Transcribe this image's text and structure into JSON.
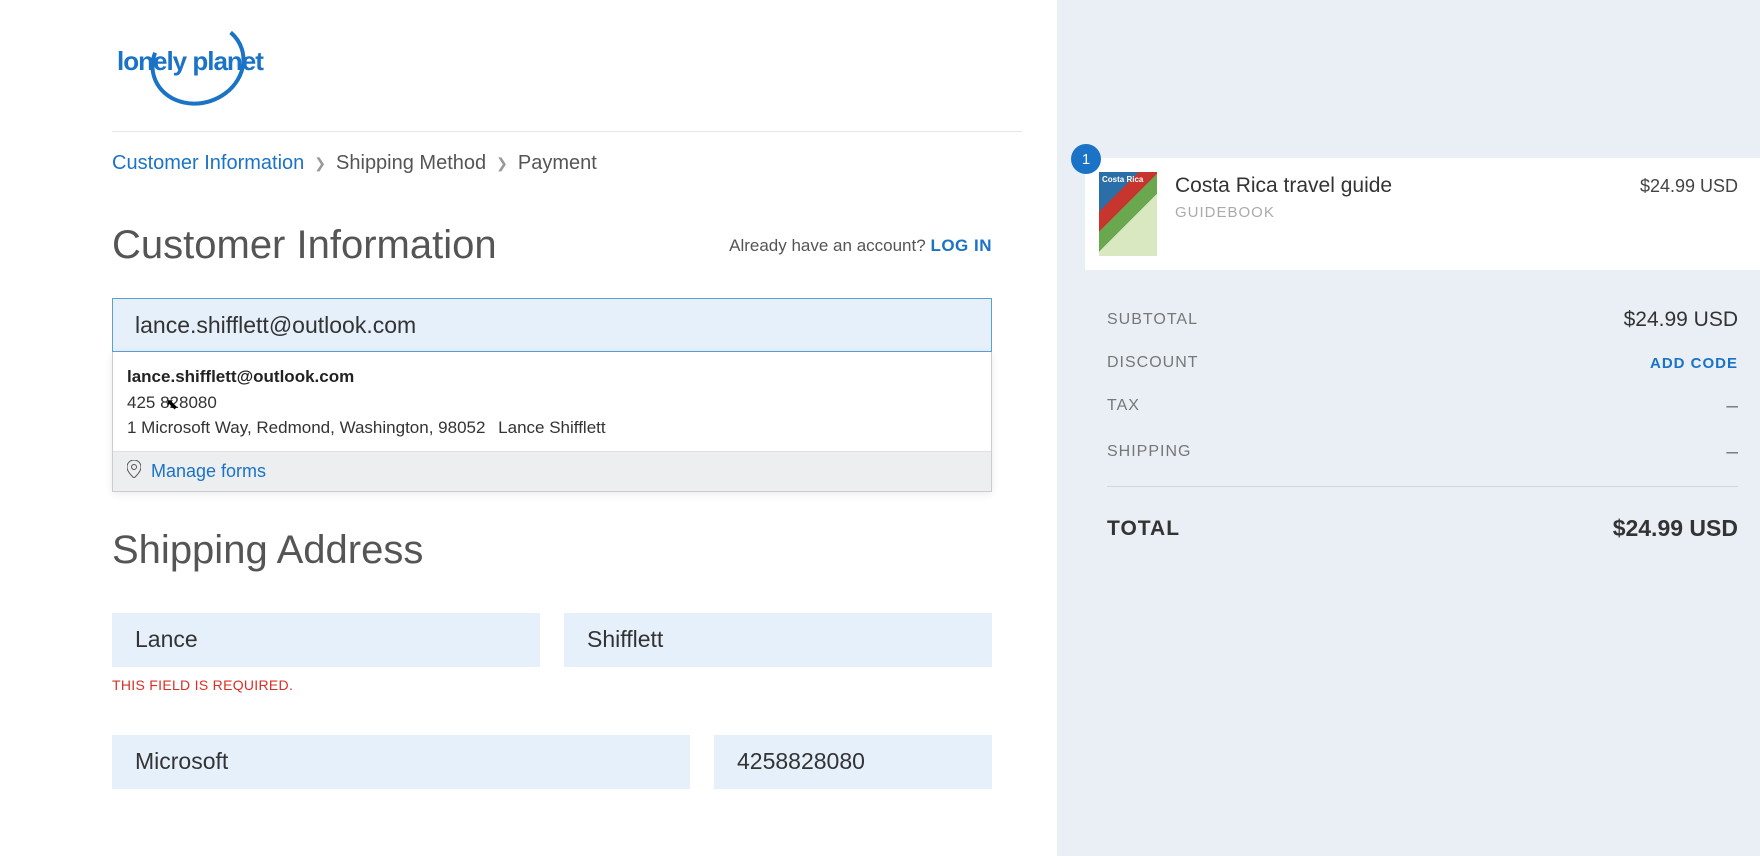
{
  "logo_alt": "lonely planet",
  "breadcrumb": {
    "step1": "Customer Information",
    "step2": "Shipping Method",
    "step3": "Payment"
  },
  "customer_info": {
    "title": "Customer Information",
    "login_prompt": "Already have an account?",
    "login_link": "LOG IN",
    "email_value": "lance.shifflett@outlook.com"
  },
  "autofill": {
    "email": "lance.shifflett@outlook.com",
    "phone": "425 828080",
    "address": "1 Microsoft Way, Redmond, Washington, 98052",
    "name": "Lance Shifflett",
    "manage_label": "Manage forms"
  },
  "shipping": {
    "title": "Shipping Address",
    "first_name": "Lance",
    "last_name": "Shifflett",
    "error": "THIS FIELD IS REQUIRED.",
    "company": "Microsoft",
    "phone": "4258828080"
  },
  "cart": {
    "qty": "1",
    "item_name": "Costa Rica travel guide",
    "item_type": "GUIDEBOOK",
    "item_price": "$24.99 USD"
  },
  "summary": {
    "subtotal_label": "SUBTOTAL",
    "subtotal_value": "$24.99 USD",
    "discount_label": "DISCOUNT",
    "discount_action": "ADD CODE",
    "tax_label": "TAX",
    "tax_value": "–",
    "shipping_label": "SHIPPING",
    "shipping_value": "–",
    "total_label": "TOTAL",
    "total_value": "$24.99 USD"
  }
}
